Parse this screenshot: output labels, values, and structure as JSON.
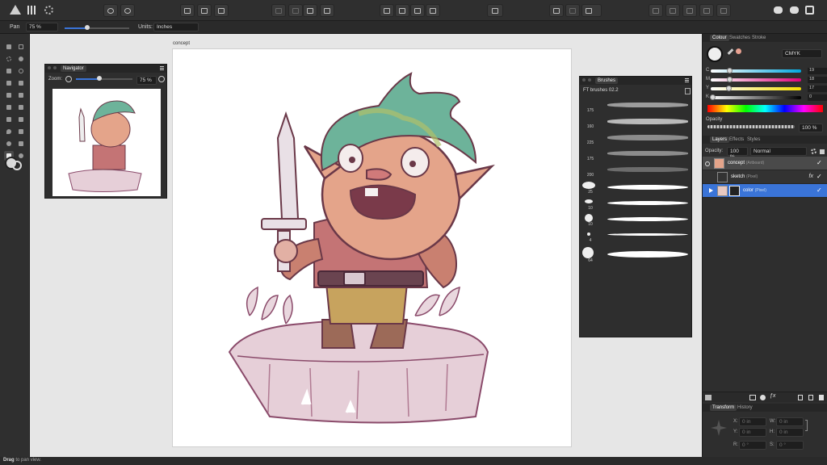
{
  "context": {
    "tool": "Pan",
    "zoom": "75 %",
    "units_label": "Units:",
    "units_value": "Inches"
  },
  "canvas": {
    "artboard_label": "concept"
  },
  "navigator": {
    "title": "Navigator",
    "zoom_label": "Zoom:",
    "zoom_value": "75 %"
  },
  "brushes": {
    "title": "Brushes",
    "category": "FT brushes 02.2",
    "sizes": [
      "175",
      "160",
      "225",
      "175",
      "200",
      "25",
      "10",
      "10",
      "4",
      "64"
    ]
  },
  "colour_panel": {
    "tabs": [
      "Colour",
      "Swatches",
      "Stroke"
    ],
    "model": "CMYK",
    "channels": [
      {
        "label": "C",
        "value": "19"
      },
      {
        "label": "M",
        "value": "18"
      },
      {
        "label": "Y",
        "value": "17"
      },
      {
        "label": "K",
        "value": "0"
      }
    ],
    "opacity_label": "Opacity",
    "opacity_value": "100 %"
  },
  "layers_panel": {
    "tabs": [
      "Layers",
      "Effects",
      "Styles"
    ],
    "opacity_label": "Opacity:",
    "opacity_value": "100 %",
    "blend_mode": "Normal",
    "layers": [
      {
        "name": "concept",
        "type": "(Artboard)"
      },
      {
        "name": "sketch",
        "type": "(Pixel)",
        "fx": "fx"
      },
      {
        "name": "color",
        "type": "(Pixel)"
      }
    ]
  },
  "transform_panel": {
    "tabs": [
      "Transform",
      "History"
    ],
    "fields": {
      "x_label": "X:",
      "x_value": "0 in",
      "w_label": "W:",
      "w_value": "0 in",
      "y_label": "Y:",
      "y_value": "0 in",
      "h_label": "H:",
      "h_value": "0 in",
      "r_label": "R:",
      "r_value": "0 °",
      "s_label": "S:",
      "s_value": "0 °"
    }
  },
  "status": {
    "bold": "Drag",
    "rest": " to pan view."
  },
  "colors": {
    "accent": "#3a74d8",
    "panel": "#2e2e2e",
    "toolbar": "#2f2f2f"
  }
}
